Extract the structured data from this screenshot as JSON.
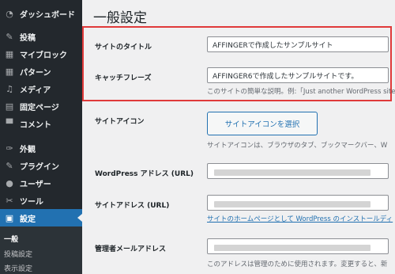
{
  "sidebar": {
    "items": [
      {
        "label": "ダッシュボード",
        "icon": "dashboard-icon",
        "glyph": "◔"
      },
      {
        "label": "投稿",
        "icon": "pin-icon",
        "glyph": "✎"
      },
      {
        "label": "マイブロック",
        "icon": "blocks-icon",
        "glyph": "▦"
      },
      {
        "label": "パターン",
        "icon": "patterns-icon",
        "glyph": "▦"
      },
      {
        "label": "メディア",
        "icon": "media-icon",
        "glyph": "♫"
      },
      {
        "label": "固定ページ",
        "icon": "page-icon",
        "glyph": "▤"
      },
      {
        "label": "コメント",
        "icon": "comment-icon",
        "glyph": "▀"
      },
      {
        "label": "外観",
        "icon": "brush-icon",
        "glyph": "✑"
      },
      {
        "label": "プラグイン",
        "icon": "plugin-icon",
        "glyph": "✎"
      },
      {
        "label": "ユーザー",
        "icon": "user-icon",
        "glyph": "●"
      },
      {
        "label": "ツール",
        "icon": "wrench-icon",
        "glyph": "✂"
      },
      {
        "label": "設定",
        "icon": "settings-icon",
        "glyph": "▣"
      }
    ],
    "submenu": [
      "一般",
      "投稿設定",
      "表示設定"
    ]
  },
  "page": {
    "title": "一般設定",
    "site_title_label": "サイトのタイトル",
    "site_title_value": "AFFINGERで作成したサンプルサイト",
    "tagline_label": "キャッチフレーズ",
    "tagline_value": "AFFINGER6で作成したサンプルサイトです。",
    "tagline_desc": "このサイトの簡単な説明。例:「Just another WordPress site",
    "site_icon_label": "サイトアイコン",
    "site_icon_button": "サイトアイコンを選択",
    "site_icon_desc": "サイトアイコンは、ブラウザのタブ、ブックマークバー、W",
    "wp_address_label": "WordPress アドレス (URL)",
    "site_address_label": "サイトアドレス (URL)",
    "site_address_desc": "サイトのホームページとして WordPress のインストールディ",
    "admin_email_label": "管理者メールアドレス",
    "admin_email_desc": "このアドレスは管理のために使用されます。変更すると、新"
  },
  "colors": {
    "accent": "#2271b1",
    "highlight_border": "#e03a3a",
    "sidebar_bg": "#23282d"
  }
}
